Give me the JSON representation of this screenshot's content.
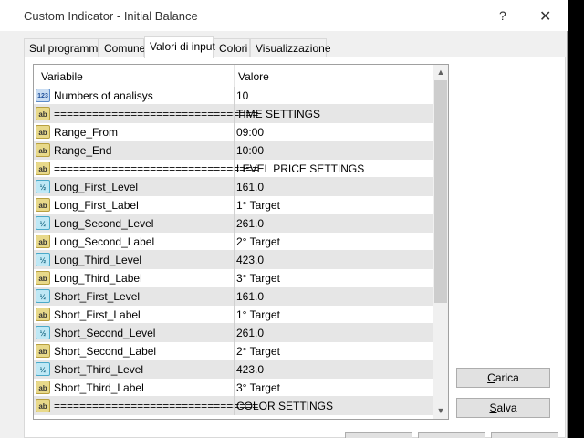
{
  "window": {
    "title": "Custom Indicator - Initial Balance",
    "help_label": "?",
    "close_label": "✕"
  },
  "tabs": [
    {
      "label": "Sul programma"
    },
    {
      "label": "Comune"
    },
    {
      "label": "Valori di input"
    },
    {
      "label": "Colori"
    },
    {
      "label": "Visualizzazione"
    }
  ],
  "grid": {
    "col_variable": "Variabile",
    "col_value": "Valore",
    "rows": [
      {
        "icon": "123",
        "name": "Numbers of analisys",
        "value": "10"
      },
      {
        "icon": "ab",
        "name": "================================",
        "value": "TIME SETTINGS"
      },
      {
        "icon": "ab",
        "name": "Range_From",
        "value": "09:00"
      },
      {
        "icon": "ab",
        "name": "Range_End",
        "value": "10:00"
      },
      {
        "icon": "ab",
        "name": "================================",
        "value": "LEVEL PRICE SETTINGS"
      },
      {
        "icon": "½",
        "name": "Long_First_Level",
        "value": "161.0"
      },
      {
        "icon": "ab",
        "name": "Long_First_Label",
        "value": "1° Target"
      },
      {
        "icon": "½",
        "name": "Long_Second_Level",
        "value": "261.0"
      },
      {
        "icon": "ab",
        "name": "Long_Second_Label",
        "value": "2° Target"
      },
      {
        "icon": "½",
        "name": "Long_Third_Level",
        "value": "423.0"
      },
      {
        "icon": "ab",
        "name": "Long_Third_Label",
        "value": "3° Target"
      },
      {
        "icon": "½",
        "name": "Short_First_Level",
        "value": "161.0"
      },
      {
        "icon": "ab",
        "name": "Short_First_Label",
        "value": "1° Target"
      },
      {
        "icon": "½",
        "name": "Short_Second_Level",
        "value": "261.0"
      },
      {
        "icon": "ab",
        "name": "Short_Second_Label",
        "value": "2° Target"
      },
      {
        "icon": "½",
        "name": "Short_Third_Level",
        "value": "423.0"
      },
      {
        "icon": "ab",
        "name": "Short_Third_Label",
        "value": "3° Target"
      },
      {
        "icon": "ab",
        "name": "================================",
        "value": "COLOR SETTINGS"
      }
    ]
  },
  "buttons": {
    "load_first": "C",
    "load_rest": "arica",
    "save_first": "S",
    "save_rest": "alva"
  }
}
